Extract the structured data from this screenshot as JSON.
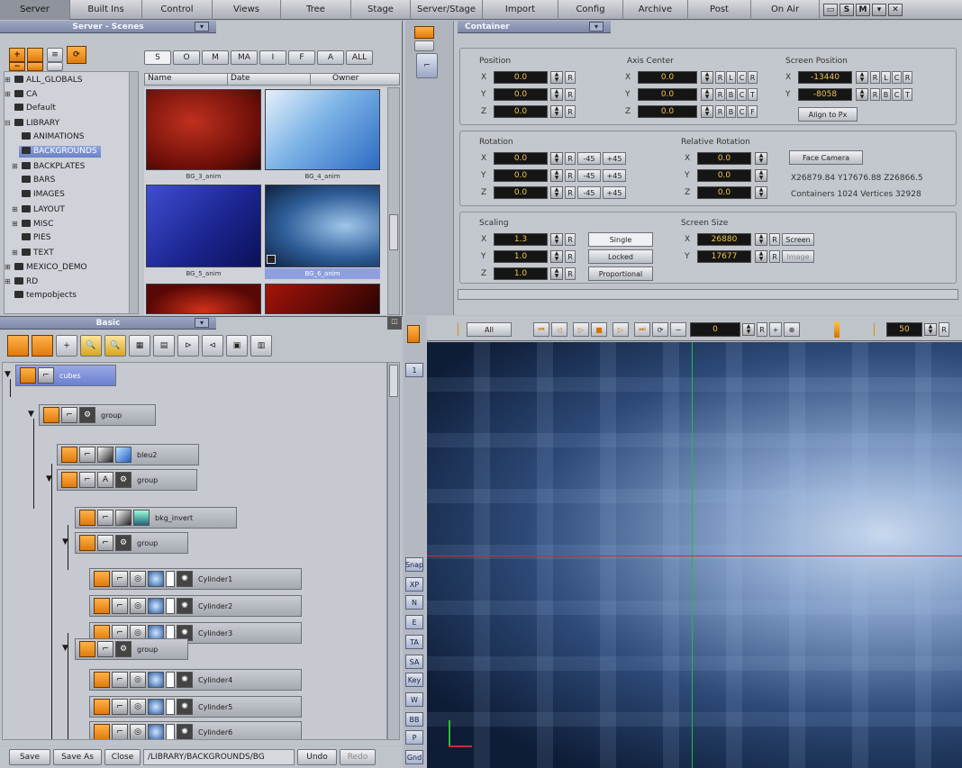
{
  "menu": [
    "Server",
    "Built Ins",
    "Control",
    "Views",
    "Tree",
    "Stage",
    "Server/Stage",
    "Import",
    "Config",
    "Archive",
    "Post",
    "On Air"
  ],
  "scenes": {
    "title": "Server - Scenes",
    "filters": [
      "S",
      "O",
      "M",
      "MA",
      "I",
      "F",
      "A",
      "ALL"
    ],
    "cols": [
      "Name",
      "Date",
      "Owner"
    ],
    "tree": [
      "ALL_GLOBALS",
      "CA",
      "Default",
      "LIBRARY",
      "ANIMATIONS",
      "BACKGROUNDS",
      "BACKPLATES",
      "BARS",
      "IMAGES",
      "LAYOUT",
      "MISC",
      "PIES",
      "TEXT",
      "MEXICO_DEMO",
      "RD",
      "tempobjects"
    ],
    "thumbs": [
      "BG_3_anim",
      "BG_4_anim",
      "BG_5_anim",
      "BG_6_anim"
    ]
  },
  "container": {
    "title": "Container",
    "position": {
      "label": "Position",
      "x": "0.0",
      "y": "0.0",
      "z": "0.0",
      "r": "R"
    },
    "axis": {
      "label": "Axis Center",
      "x": "0.0",
      "y": "0.0",
      "z": "0.0",
      "xb": [
        "R",
        "L",
        "C",
        "R"
      ],
      "yb": [
        "R",
        "B",
        "C",
        "T"
      ],
      "zb": [
        "R",
        "B",
        "C",
        "F"
      ]
    },
    "screenpos": {
      "label": "Screen Position",
      "x": "-13440",
      "y": "-8058",
      "xb": [
        "R",
        "L",
        "C",
        "R"
      ],
      "yb": [
        "R",
        "B",
        "C",
        "T"
      ],
      "align": "Align to Px"
    },
    "rotation": {
      "label": "Rotation",
      "x": "0.0",
      "y": "0.0",
      "z": "0.0",
      "m": "-45",
      "p": "+45"
    },
    "relrot": {
      "label": "Relative Rotation",
      "x": "0.0",
      "y": "0.0",
      "z": "0.0"
    },
    "face": "Face Camera",
    "info1": "X26879.84 Y17676.88 Z26866.5",
    "info2": "Containers 1024  Vertices 32928",
    "scaling": {
      "label": "Scaling",
      "x": "1.3",
      "y": "1.0",
      "z": "1.0",
      "single": "Single",
      "locked": "Locked",
      "prop": "Proportional"
    },
    "screensize": {
      "label": "Screen Size",
      "x": "26880",
      "y": "17677",
      "screen": "Screen",
      "image": "Image"
    }
  },
  "axislabels": {
    "x": "X",
    "y": "Y",
    "z": "Z"
  },
  "basic": {
    "title": "Basic"
  },
  "nodes": [
    "cubes",
    "group",
    "bleu2",
    "group",
    "bkg_invert",
    "group",
    "Cylinder1",
    "Cylinder2",
    "Cylinder3",
    "group",
    "Cylinder4",
    "Cylinder5",
    "Cylinder6"
  ],
  "sidebtns": [
    "Snap",
    "XP",
    "N",
    "E",
    "TA",
    "SA",
    "Key",
    "W",
    "BB",
    "P",
    "Gnd"
  ],
  "sidenum": "1",
  "play": {
    "all": "All",
    "frame": "0",
    "end": "50",
    "r": "R"
  },
  "bottom": {
    "save": "Save",
    "saveas": "Save As",
    "close": "Close",
    "path": "/LIBRARY/BACKGROUNDS/BG",
    "undo": "Undo",
    "redo": "Redo"
  }
}
